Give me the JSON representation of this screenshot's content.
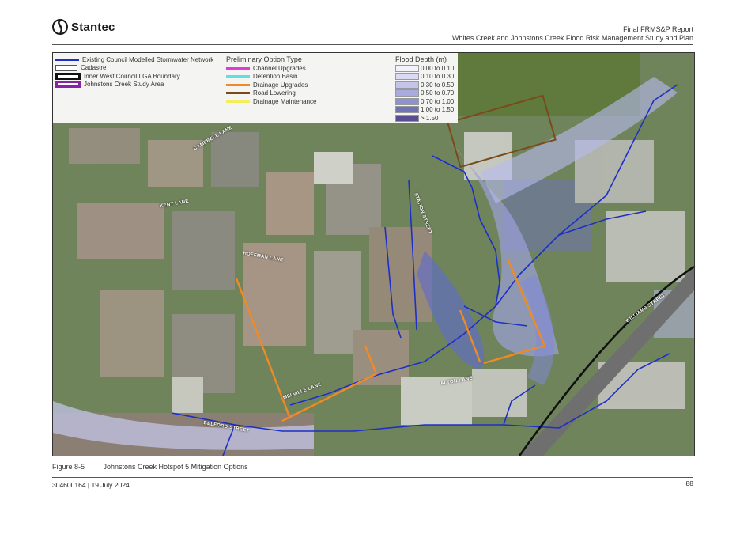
{
  "header": {
    "brand": "Stantec",
    "brand_icon": "stantec-logo-icon",
    "report_title": "Final FRMS&P Report",
    "report_subtitle": "Whites Creek and Johnstons Creek Flood Risk Management Study and Plan"
  },
  "legend": {
    "network_items": [
      {
        "label": "Existing Council Modelled Stormwater Network",
        "color": "#1d2fc7",
        "style": "line"
      },
      {
        "label": "Cadastre",
        "color": "#ffffff",
        "style": "box"
      },
      {
        "label": "Inner West Council LGA Boundary",
        "color": "#111111",
        "style": "thick-box"
      },
      {
        "label": "Johnstons Creek Study Area",
        "color": "#8a1fa8",
        "style": "thick-box"
      }
    ],
    "option_title": "Preliminary Option Type",
    "option_items": [
      {
        "label": "Channel Upgrades",
        "color": "#e03ad8"
      },
      {
        "label": "Detention Basin",
        "color": "#5fe0e0"
      },
      {
        "label": "Drainage Upgrades",
        "color": "#f08a24"
      },
      {
        "label": "Road Lowering",
        "color": "#7a4a1a"
      },
      {
        "label": "Drainage Maintenance",
        "color": "#f3ef5a"
      }
    ],
    "depth_title": "Flood Depth (m)",
    "depth_items": [
      {
        "label": "0.00 to 0.10",
        "color": "#f3f2fb"
      },
      {
        "label": "0.10 to 0.30",
        "color": "#dcdaf2"
      },
      {
        "label": "0.30 to 0.50",
        "color": "#c4c3ea"
      },
      {
        "label": "0.50 to 0.70",
        "color": "#a9aadf"
      },
      {
        "label": "0.70 to 1.00",
        "color": "#8d93cf"
      },
      {
        "label": "1.00 to 1.50",
        "color": "#6f74b6"
      },
      {
        "label": "> 1.50",
        "color": "#5a4e92"
      }
    ]
  },
  "streets": [
    {
      "label": "CAMPBELL LANE"
    },
    {
      "label": "HOFFMAN LANE"
    },
    {
      "label": "MELVILLE LANE"
    },
    {
      "label": "ALTON LANE"
    },
    {
      "label": "BELFORD STREET"
    },
    {
      "label": "KENT LANE"
    },
    {
      "label": "STATION STREET"
    },
    {
      "label": "WILLIAMS STREET"
    }
  ],
  "caption": {
    "figure_number": "Figure 8-5",
    "figure_title": "Johnstons Creek Hotspot 5 Mitigation Options"
  },
  "footer": {
    "doc_ref": "304600164 | 19 July 2024",
    "page_number": "88"
  }
}
